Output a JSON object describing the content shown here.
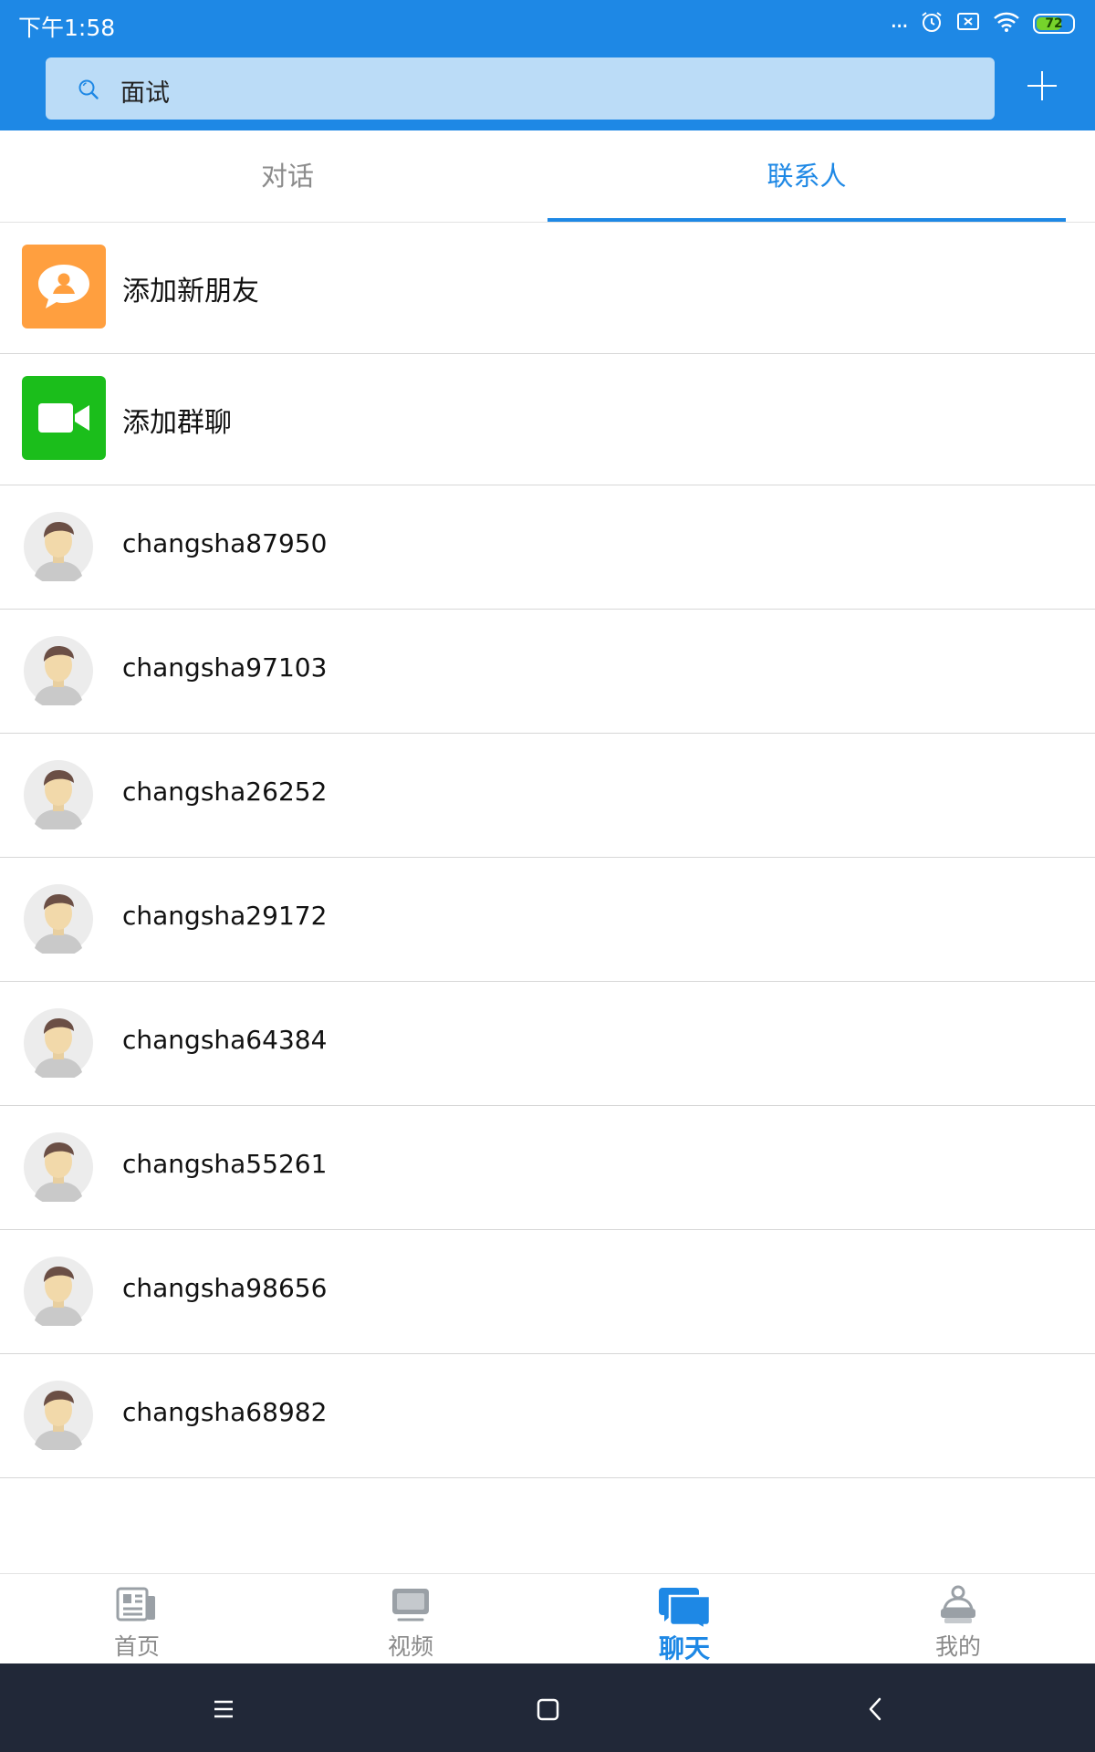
{
  "status_bar": {
    "time": "下午1:58",
    "dots": "...",
    "battery_level": "72",
    "battery_fraction": 0.72,
    "battery_color": "#76D32B"
  },
  "header": {
    "background": "#1E88E5",
    "search_text": "面试",
    "search_icon": "search-icon",
    "add_icon": "plus-icon"
  },
  "tabs": [
    {
      "label": "对话",
      "active": false
    },
    {
      "label": "联系人",
      "active": true
    }
  ],
  "special_items": [
    {
      "label": "添加新朋友",
      "icon": "add-friend-icon",
      "color": "#FF9F3F"
    },
    {
      "label": "添加群聊",
      "icon": "video-camera-icon",
      "color": "#1BBE1B"
    }
  ],
  "contacts": [
    {
      "name": "changsha87950"
    },
    {
      "name": "changsha97103"
    },
    {
      "name": "changsha26252"
    },
    {
      "name": "changsha29172"
    },
    {
      "name": "changsha64384"
    },
    {
      "name": "changsha55261"
    },
    {
      "name": "changsha98656"
    },
    {
      "name": "changsha68982"
    }
  ],
  "bottom_nav": [
    {
      "label": "首页",
      "icon": "home-newspaper-icon",
      "active": false
    },
    {
      "label": "视频",
      "icon": "video-screen-icon",
      "active": false
    },
    {
      "label": "聊天",
      "icon": "chat-bubble-icon",
      "active": true
    },
    {
      "label": "我的",
      "icon": "profile-icon",
      "active": false
    }
  ],
  "accent": "#1E88E5"
}
